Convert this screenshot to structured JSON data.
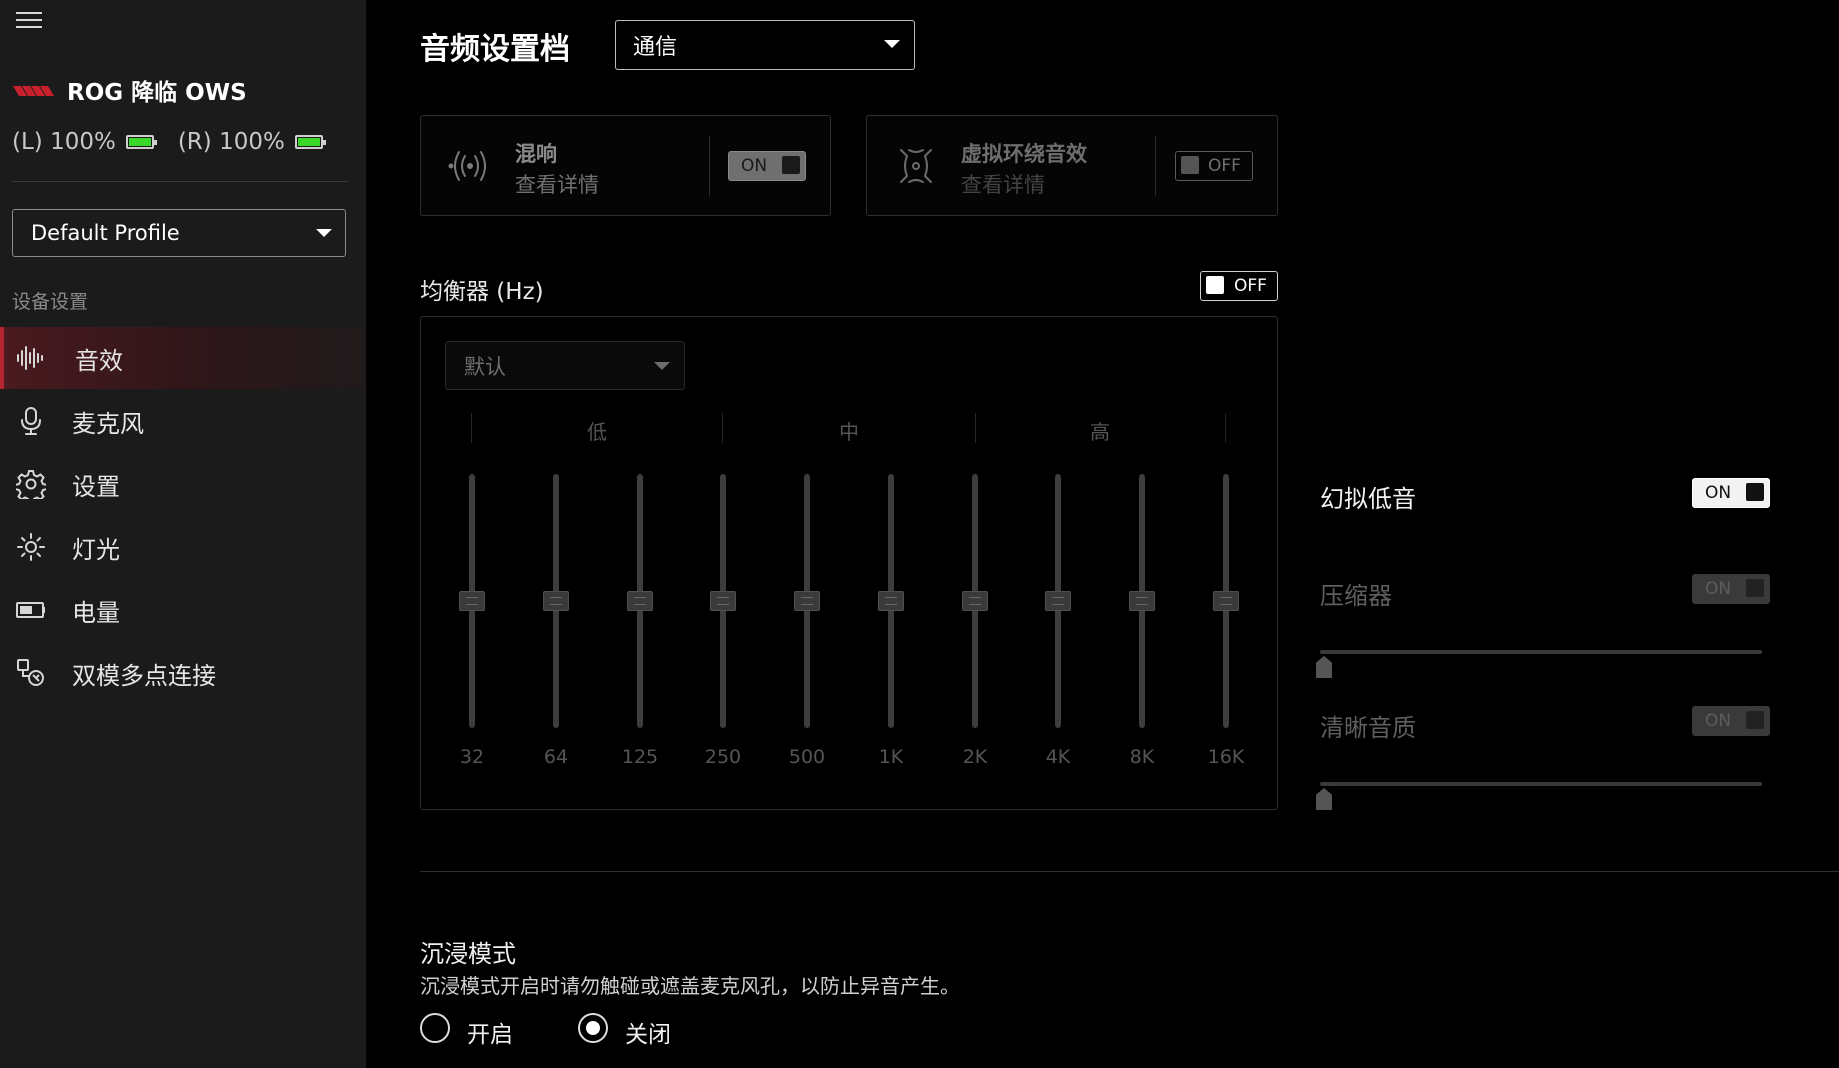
{
  "sidebar": {
    "device_name": "ROG 降临 OWS",
    "battery": [
      {
        "label": "(L) 100%",
        "level": 1.0
      },
      {
        "label": "(R) 100%",
        "level": 1.0
      }
    ],
    "profile_select": "Default Profile",
    "section_label": "设备设置",
    "nav": [
      {
        "label": "音效",
        "icon": "sound-wave-icon",
        "active": true
      },
      {
        "label": "麦克风",
        "icon": "microphone-icon",
        "active": false
      },
      {
        "label": "设置",
        "icon": "gear-icon",
        "active": false
      },
      {
        "label": "灯光",
        "icon": "light-icon",
        "active": false
      },
      {
        "label": "电量",
        "icon": "battery-icon",
        "active": false
      },
      {
        "label": "双模多点连接",
        "icon": "multipoint-connection-icon",
        "active": false
      }
    ]
  },
  "main": {
    "title": "音频设置档",
    "mode_select": "通信",
    "cards": [
      {
        "title": "混响",
        "subtitle": "查看详情",
        "toggle": "ON",
        "icon": "reverb-icon"
      },
      {
        "title": "虚拟环绕音效",
        "subtitle": "查看详情",
        "toggle": "OFF",
        "icon": "surround-icon"
      }
    ],
    "eq": {
      "title": "均衡器 (Hz)",
      "toggle": "OFF",
      "preset": "默认",
      "bands": [
        "低",
        "中",
        "高"
      ],
      "frequencies": [
        "32",
        "64",
        "125",
        "250",
        "500",
        "1K",
        "2K",
        "4K",
        "8K",
        "16K"
      ],
      "levels": [
        0,
        0,
        0,
        0,
        0,
        0,
        0,
        0,
        0,
        0
      ]
    },
    "right": {
      "phantom_bass": {
        "label": "幻拟低音",
        "toggle": "ON"
      },
      "compressor": {
        "label": "压缩器",
        "toggle": "ON",
        "level": 0
      },
      "clarity": {
        "label": "清晰音质",
        "toggle": "ON",
        "level": 0
      }
    },
    "immersion": {
      "title": "沉浸模式",
      "description": "沉浸模式开启时请勿触碰或遮盖麦克风孔，以防止异音产生。",
      "options": [
        {
          "label": "开启",
          "selected": false
        },
        {
          "label": "关闭",
          "selected": true
        }
      ]
    }
  },
  "colors": {
    "accent_red": "#b52632",
    "battery_green": "#39d829",
    "sidebar_bg": "#1b1b1b",
    "main_bg": "#000000"
  }
}
